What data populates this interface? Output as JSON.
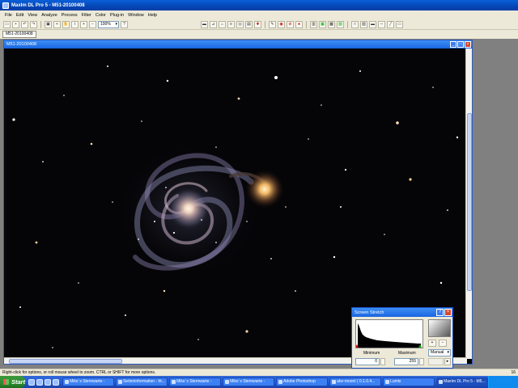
{
  "app": {
    "title": "MaxIm DL Pro 5 - M51-20100408"
  },
  "menu": [
    "File",
    "Edit",
    "View",
    "Analyze",
    "Process",
    "Filter",
    "Color",
    "Plug-in",
    "Window",
    "Help"
  ],
  "toolbar": {
    "zoom_value": "100%"
  },
  "document_tab": {
    "label": "M51-20100408"
  },
  "image_window": {
    "title": "M51-20100408"
  },
  "screen_stretch": {
    "title": "Screen Stretch",
    "minimum_label": "Minimum",
    "maximum_label": "Maximum",
    "minimum_value": "0",
    "maximum_value": "255",
    "mode": "Manual"
  },
  "statusbar": {
    "hint": "Right-click for options, or roll mouse wheel to zoom. CTRL or SHIFT for more options.",
    "right_text": "16"
  },
  "taskbar": {
    "start_label": "Start",
    "items": [
      "Mike´s Sternwarte -",
      "Seiteninformation - ht...",
      "Mike´s Sternwarte -",
      "Mike´s Sternwarte -",
      "Adobe Photoshop",
      "abv-moonl ( 0.1.0.4...",
      "Lumix",
      "MaxIm DL Pro 5 - M5..."
    ]
  },
  "colors": {
    "titlebar": "#0a5fd8",
    "image_bg": "#050508",
    "chrome": "#ece9d8"
  }
}
